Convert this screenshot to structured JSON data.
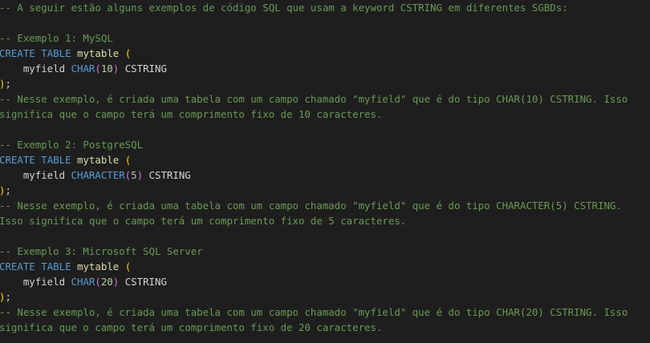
{
  "colors": {
    "background": "#1e1e1e",
    "comment": "#6a9955",
    "keyword": "#569cd6",
    "identifier": "#9cdcfe",
    "number": "#b5cea8",
    "text": "#d4d4d4",
    "bracket_outer": "#ffd700",
    "bracket_inner": "#da70d6"
  },
  "lines": [
    [
      {
        "t": "-- A seguir estão alguns exemplos de código SQL que usam a keyword CSTRING em diferentes SGBDs:",
        "c": "comment"
      }
    ],
    [],
    [
      {
        "t": "-- Exemplo 1: MySQL",
        "c": "comment"
      }
    ],
    [
      {
        "t": "CREATE",
        "c": "keyword"
      },
      {
        "t": " ",
        "c": "plain"
      },
      {
        "t": "TABLE",
        "c": "keyword"
      },
      {
        "t": " ",
        "c": "plain"
      },
      {
        "t": "mytable",
        "c": "func"
      },
      {
        "t": " ",
        "c": "plain"
      },
      {
        "t": "(",
        "c": "bracket"
      }
    ],
    [
      {
        "t": "    myfield ",
        "c": "plain"
      },
      {
        "t": "CHAR",
        "c": "type"
      },
      {
        "t": "(",
        "c": "bracket2"
      },
      {
        "t": "10",
        "c": "num"
      },
      {
        "t": ")",
        "c": "bracket2"
      },
      {
        "t": " CSTRING",
        "c": "plain"
      }
    ],
    [
      {
        "t": ")",
        "c": "bracket"
      },
      {
        "t": ";",
        "c": "plain"
      }
    ],
    [
      {
        "t": "-- Nesse exemplo, é criada uma tabela com um campo chamado \"myfield\" que é do tipo CHAR(10) CSTRING. Isso",
        "c": "comment"
      }
    ],
    [
      {
        "t": "significa que o campo terá um comprimento fixo de 10 caracteres.",
        "c": "comment"
      }
    ],
    [],
    [
      {
        "t": "-- Exemplo 2: PostgreSQL",
        "c": "comment"
      }
    ],
    [
      {
        "t": "CREATE",
        "c": "keyword"
      },
      {
        "t": " ",
        "c": "plain"
      },
      {
        "t": "TABLE",
        "c": "keyword"
      },
      {
        "t": " ",
        "c": "plain"
      },
      {
        "t": "mytable",
        "c": "func"
      },
      {
        "t": " ",
        "c": "plain"
      },
      {
        "t": "(",
        "c": "bracket"
      }
    ],
    [
      {
        "t": "    myfield ",
        "c": "plain"
      },
      {
        "t": "CHARACTER",
        "c": "type"
      },
      {
        "t": "(",
        "c": "bracket2"
      },
      {
        "t": "5",
        "c": "num"
      },
      {
        "t": ")",
        "c": "bracket2"
      },
      {
        "t": " CSTRING",
        "c": "plain"
      }
    ],
    [
      {
        "t": ")",
        "c": "bracket"
      },
      {
        "t": ";",
        "c": "plain"
      }
    ],
    [
      {
        "t": "-- Nesse exemplo, é criada uma tabela com um campo chamado \"myfield\" que é do tipo CHARACTER(5) CSTRING.",
        "c": "comment"
      }
    ],
    [
      {
        "t": "Isso significa que o campo terá um comprimento fixo de 5 caracteres.",
        "c": "comment"
      }
    ],
    [],
    [
      {
        "t": "-- Exemplo 3: Microsoft SQL Server",
        "c": "comment"
      }
    ],
    [
      {
        "t": "CREATE",
        "c": "keyword"
      },
      {
        "t": " ",
        "c": "plain"
      },
      {
        "t": "TABLE",
        "c": "keyword"
      },
      {
        "t": " ",
        "c": "plain"
      },
      {
        "t": "mytable",
        "c": "func"
      },
      {
        "t": " ",
        "c": "plain"
      },
      {
        "t": "(",
        "c": "bracket"
      }
    ],
    [
      {
        "t": "    myfield ",
        "c": "plain"
      },
      {
        "t": "CHAR",
        "c": "type"
      },
      {
        "t": "(",
        "c": "bracket2"
      },
      {
        "t": "20",
        "c": "num"
      },
      {
        "t": ")",
        "c": "bracket2"
      },
      {
        "t": " CSTRING",
        "c": "plain"
      }
    ],
    [
      {
        "t": ")",
        "c": "bracket"
      },
      {
        "t": ";",
        "c": "plain"
      }
    ],
    [
      {
        "t": "-- Nesse exemplo, é criada uma tabela com um campo chamado \"myfield\" que é do tipo CHAR(20) CSTRING. Isso",
        "c": "comment"
      }
    ],
    [
      {
        "t": "significa que o campo terá um comprimento fixo de 20 caracteres.",
        "c": "comment"
      }
    ]
  ]
}
